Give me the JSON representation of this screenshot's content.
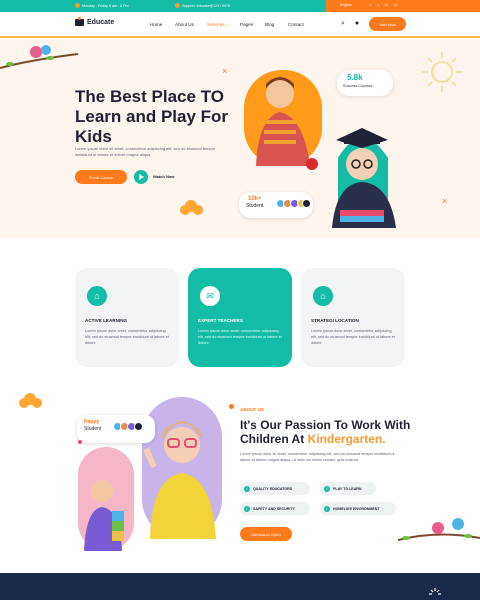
{
  "topbar": {
    "hours": "Monday - Friday 8 am - 5 Pm",
    "email": "Support: educate@123 / 9478",
    "language": "English",
    "social": [
      "f",
      "t",
      "in",
      "◎"
    ]
  },
  "header": {
    "logo_text": "Educate",
    "nav": [
      "Home",
      "About Us",
      "Services",
      "Pages",
      "Blog",
      "Contact"
    ],
    "active_nav": "Services",
    "login_label": "Join Now"
  },
  "hero": {
    "title": "The Best Place TO Learn and Play For Kids",
    "text": "Lorem ipsum dolor sit amet, consectetur adipiscing elit, sed do eiusmod tempor incididunt ut labore et dolore magna aliqua.",
    "cta_label": "Enroll Course",
    "watch_label": "Watch Now",
    "courses_count": "5.8k",
    "courses_label": "Success Courses",
    "students_count": "10k+",
    "students_label": "Student"
  },
  "features": [
    {
      "title": "ACTIVE LEARNING",
      "text": "Lorem ipsum dolor amet, consectetur adipiscing elit, sed do eiusmod tempor incididunt ut labore et dolore",
      "active": false
    },
    {
      "title": "EXPERT TEACHERS",
      "text": "Lorem ipsum dolor amet, consectetur adipiscing elit, sed do eiusmod tempor incididunt ut labore et dolore",
      "active": true
    },
    {
      "title": "STRATEGI LOCATION",
      "text": "Lorem ipsum dolor amet, consectetur adipiscing elit, sed do eiusmod tempor incididunt ut labore et dolore",
      "active": false
    }
  ],
  "about": {
    "label": "ABOUT US",
    "title_main": "It's Our Passion To Work With Children At",
    "title_highlight": "Kindergarten.",
    "text": "Lorem ipsum dolor sit amet, consectetur adipiscing elit, sed do eiusmod tempor incididunt ut labore et dolore magna aliqua. Ut enim ad minim veniam, quis nostrud.",
    "happy_top": "Happy",
    "happy_bottom": "Student",
    "features": [
      "QUALITY EDUCATORS",
      "PLAY TO LEARN",
      "SAFETY AND SECURITY",
      "HOMELIKE ENVIRONMENT"
    ],
    "cta_label": "Admission Open"
  },
  "colors": {
    "teal": "#14bba5",
    "orange": "#ff7a1a",
    "navy": "#1b2a4a"
  }
}
